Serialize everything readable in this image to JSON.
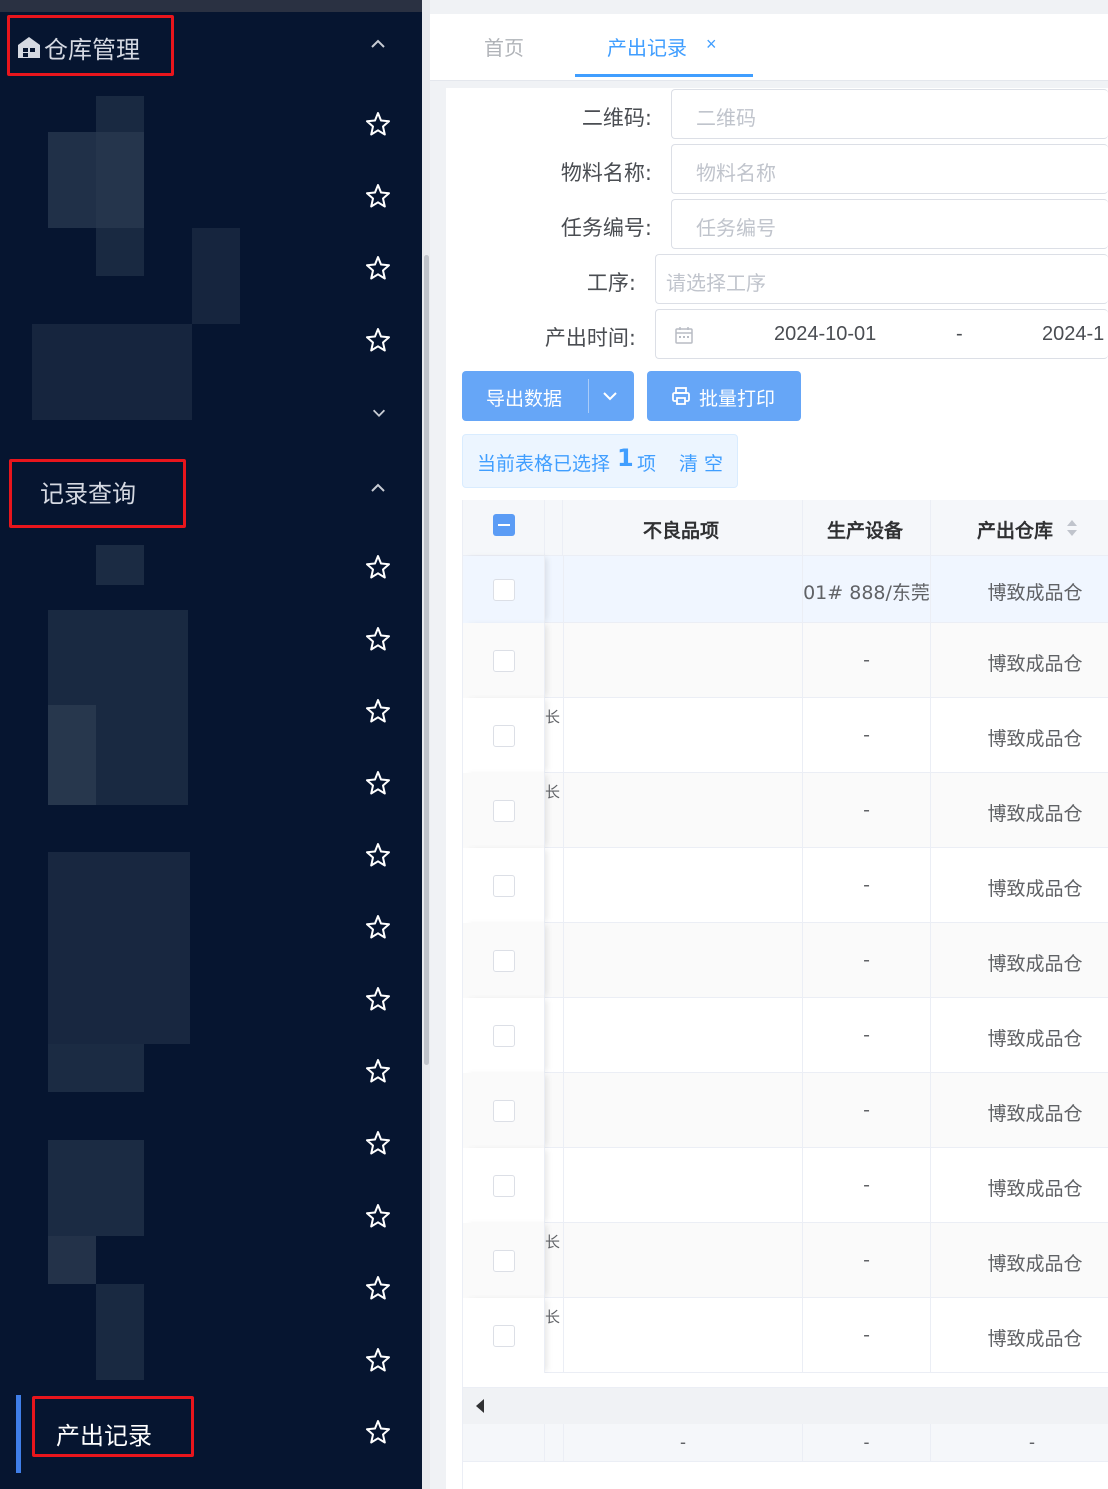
{
  "sidebar": {
    "group_warehouse": {
      "label": "仓库管理"
    },
    "group_records": {
      "label": "记录查询"
    },
    "active_item": {
      "label": "产出记录"
    }
  },
  "tabs": [
    {
      "label": "首页"
    },
    {
      "label": "产出记录"
    }
  ],
  "tab_close": "×",
  "form": {
    "qrcode": {
      "label": "二维码:",
      "placeholder": "二维码"
    },
    "material": {
      "label": "物料名称:",
      "placeholder": "物料名称"
    },
    "task": {
      "label": "任务编号:",
      "placeholder": "任务编号"
    },
    "process": {
      "label": "工序:",
      "placeholder": "请选择工序"
    },
    "time": {
      "label": "产出时间:",
      "start": "2024-10-01",
      "sep": "-",
      "end": "2024-1"
    }
  },
  "toolbar": {
    "export_label": "导出数据",
    "print_label": "批量打印"
  },
  "selection": {
    "prefix": "当前表格已选择",
    "count": "1",
    "suffix": "项",
    "clear": "清 空"
  },
  "table": {
    "headers": {
      "defect": "不良品项",
      "device": "生产设备",
      "warehouse": "产出仓库"
    },
    "fragment": "长",
    "rows": [
      {
        "device": "01# 888/东莞",
        "warehouse": "博致成品仓",
        "checked": true
      },
      {
        "device": "-",
        "warehouse": "博致成品仓"
      },
      {
        "device": "-",
        "warehouse": "博致成品仓"
      },
      {
        "device": "-",
        "warehouse": "博致成品仓"
      },
      {
        "device": "-",
        "warehouse": "博致成品仓"
      },
      {
        "device": "-",
        "warehouse": "博致成品仓"
      },
      {
        "device": "-",
        "warehouse": "博致成品仓"
      },
      {
        "device": "-",
        "warehouse": "博致成品仓"
      },
      {
        "device": "-",
        "warehouse": "博致成品仓"
      },
      {
        "device": "-",
        "warehouse": "博致成品仓"
      },
      {
        "device": "-",
        "warehouse": "博致成品仓"
      }
    ],
    "summary": {
      "defect": "-",
      "device": "-",
      "warehouse": "-"
    }
  }
}
